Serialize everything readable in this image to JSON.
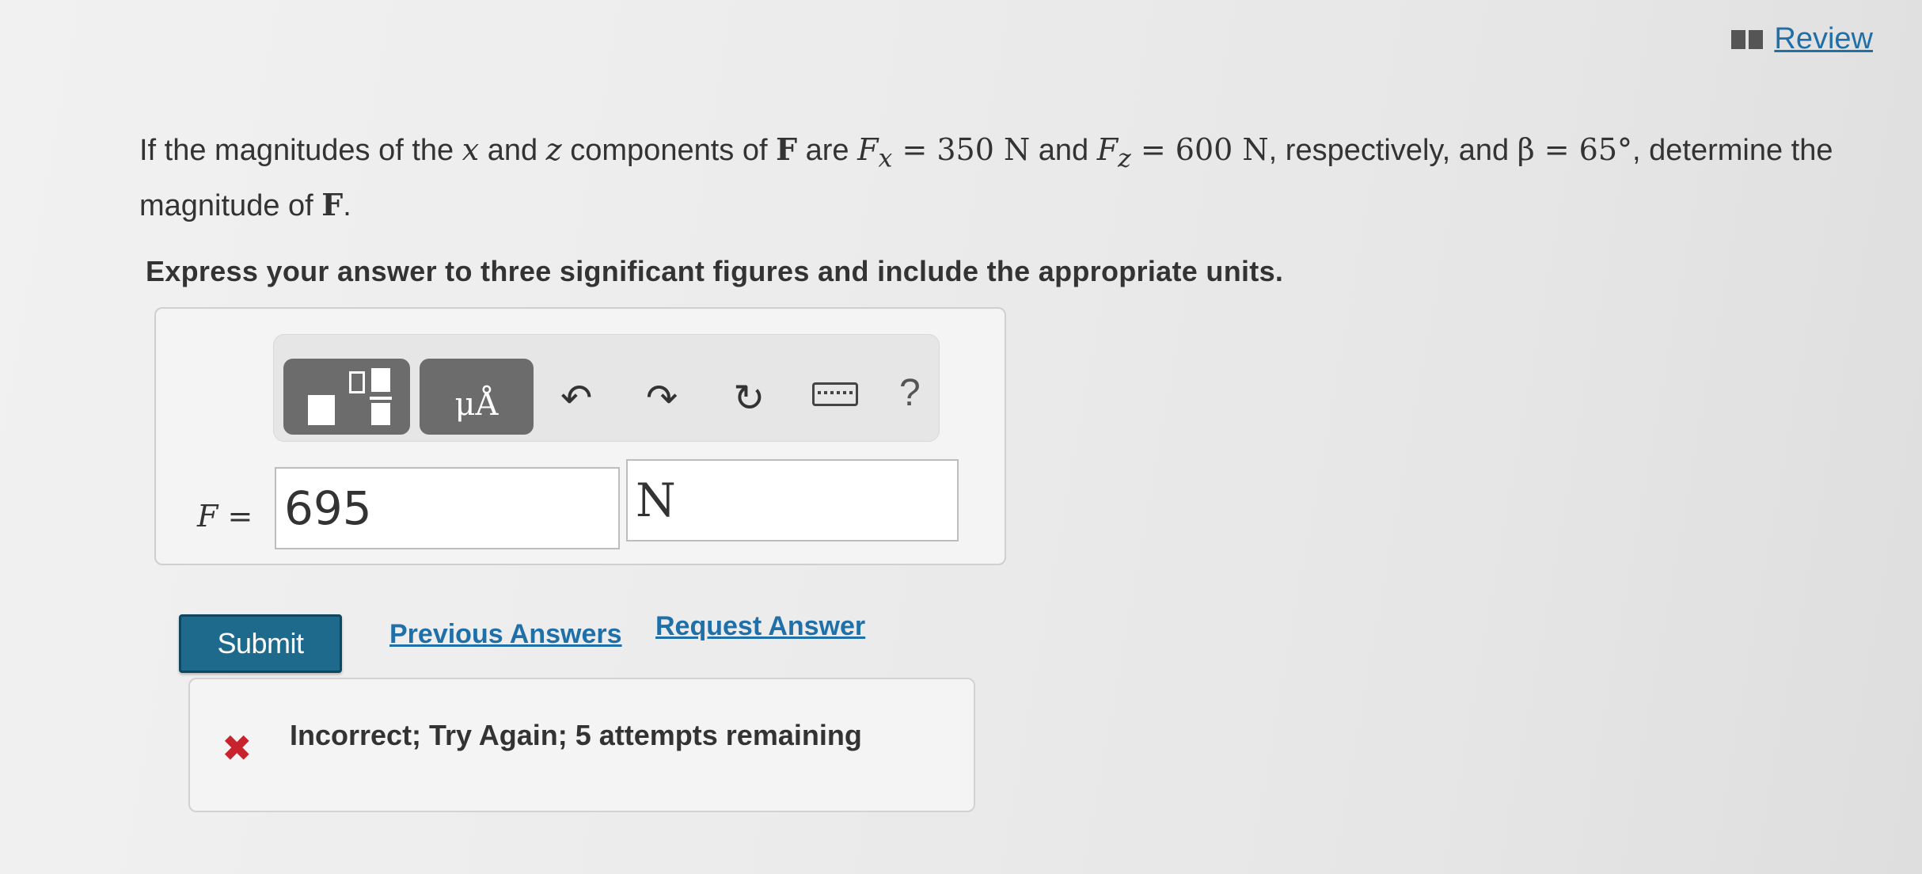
{
  "header": {
    "review_label": "Review",
    "review_icon": "book-icon"
  },
  "problem": {
    "text_1": "If the magnitudes of the ",
    "var_x": "x",
    "text_2": " and ",
    "var_z": "z",
    "text_3": " components of ",
    "vec_F": "F",
    "text_4": " are ",
    "Fx_sym": "F",
    "Fx_sub": "x",
    "Fx_val": " = 350 N",
    "text_5": " and ",
    "Fz_sym": "F",
    "Fz_sub": "z",
    "Fz_val": " = 600 N",
    "text_6": ", respectively, and ",
    "beta": "β = 65°",
    "text_7": ", determine the magnitude of ",
    "vec_F2": "F",
    "text_8": "."
  },
  "instruction": "Express your answer to three significant figures and include the appropriate units.",
  "toolbar": {
    "units_label": "μÅ",
    "undo_glyph": "↶",
    "redo_glyph": "↷",
    "reset_glyph": "↻",
    "help_glyph": "?"
  },
  "answer": {
    "label_var": "F",
    "label_eq": " =",
    "value": "695",
    "unit": "N"
  },
  "actions": {
    "submit_label": "Submit",
    "previous_answers_label": "Previous Answers",
    "request_answer_label": "Request Answer"
  },
  "feedback": {
    "icon": "x-icon",
    "icon_glyph": "✖",
    "color": "#c8232c",
    "text": "Incorrect; Try Again; 5 attempts remaining"
  }
}
